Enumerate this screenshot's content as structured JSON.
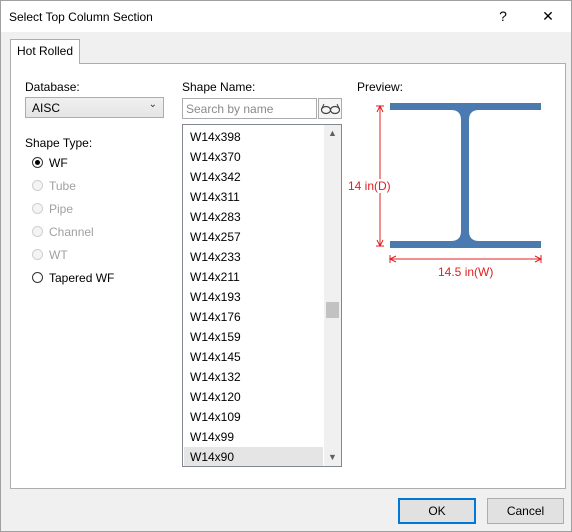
{
  "window": {
    "title": "Select  Top Column Section",
    "help_label": "?",
    "close_label": "✕"
  },
  "tabs": [
    {
      "label": "Hot Rolled",
      "active": true
    }
  ],
  "database": {
    "label": "Database:",
    "value": "AISC"
  },
  "shape_type": {
    "label": "Shape Type:",
    "options": [
      {
        "label": "WF",
        "checked": true,
        "enabled": true
      },
      {
        "label": "Tube",
        "checked": false,
        "enabled": false
      },
      {
        "label": "Pipe",
        "checked": false,
        "enabled": false
      },
      {
        "label": "Channel",
        "checked": false,
        "enabled": false
      },
      {
        "label": "WT",
        "checked": false,
        "enabled": false
      },
      {
        "label": "Tapered WF",
        "checked": false,
        "enabled": true
      }
    ]
  },
  "shape_name": {
    "label": "Shape Name:",
    "search_placeholder": "Search by name",
    "search_value": "",
    "items": [
      "W14x398",
      "W14x370",
      "W14x342",
      "W14x311",
      "W14x283",
      "W14x257",
      "W14x233",
      "W14x211",
      "W14x193",
      "W14x176",
      "W14x159",
      "W14x145",
      "W14x132",
      "W14x120",
      "W14x109",
      "W14x99",
      "W14x90"
    ],
    "selected": "W14x90"
  },
  "preview": {
    "label": "Preview:",
    "depth_label": "14 in(D)",
    "width_label": "14.5 in(W)",
    "section_color": "#4a7ab0",
    "dimension_color": "#e02020"
  },
  "footer": {
    "ok_label": "OK",
    "cancel_label": "Cancel"
  }
}
